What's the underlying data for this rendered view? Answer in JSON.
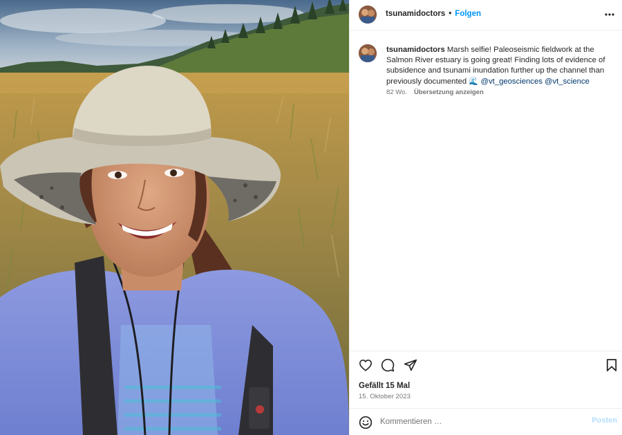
{
  "post": {
    "username": "tsunamidoctors",
    "separator": "•",
    "follow_label": "Folgen",
    "more_icon": "more-horizontal-icon",
    "caption": {
      "username": "tsunamidoctors",
      "text": "Marsh selfie! Paleoseismic fieldwork at the Salmon River estuary is going great! Finding lots of evidence of subsidence and tsunami inundation further up the channel than previously documented",
      "emoji": "🌊",
      "mentions": [
        "@vt_geosciences",
        "@vt_science"
      ]
    },
    "age": "82 Wo.",
    "translate_label": "Übersetzung anzeigen",
    "likes_text": "Gefällt 15 Mal",
    "date": "15. Oktober 2023",
    "comment_placeholder": "Kommentieren …",
    "post_button_label": "Posten",
    "icons": {
      "like": "heart-icon",
      "comment": "comment-bubble-icon",
      "share": "paper-plane-icon",
      "save": "bookmark-icon",
      "emoji": "smiley-icon"
    },
    "colors": {
      "link": "#0095f6",
      "mention": "#00376b",
      "muted": "#737373",
      "post_disabled": "#b3dffc"
    }
  }
}
